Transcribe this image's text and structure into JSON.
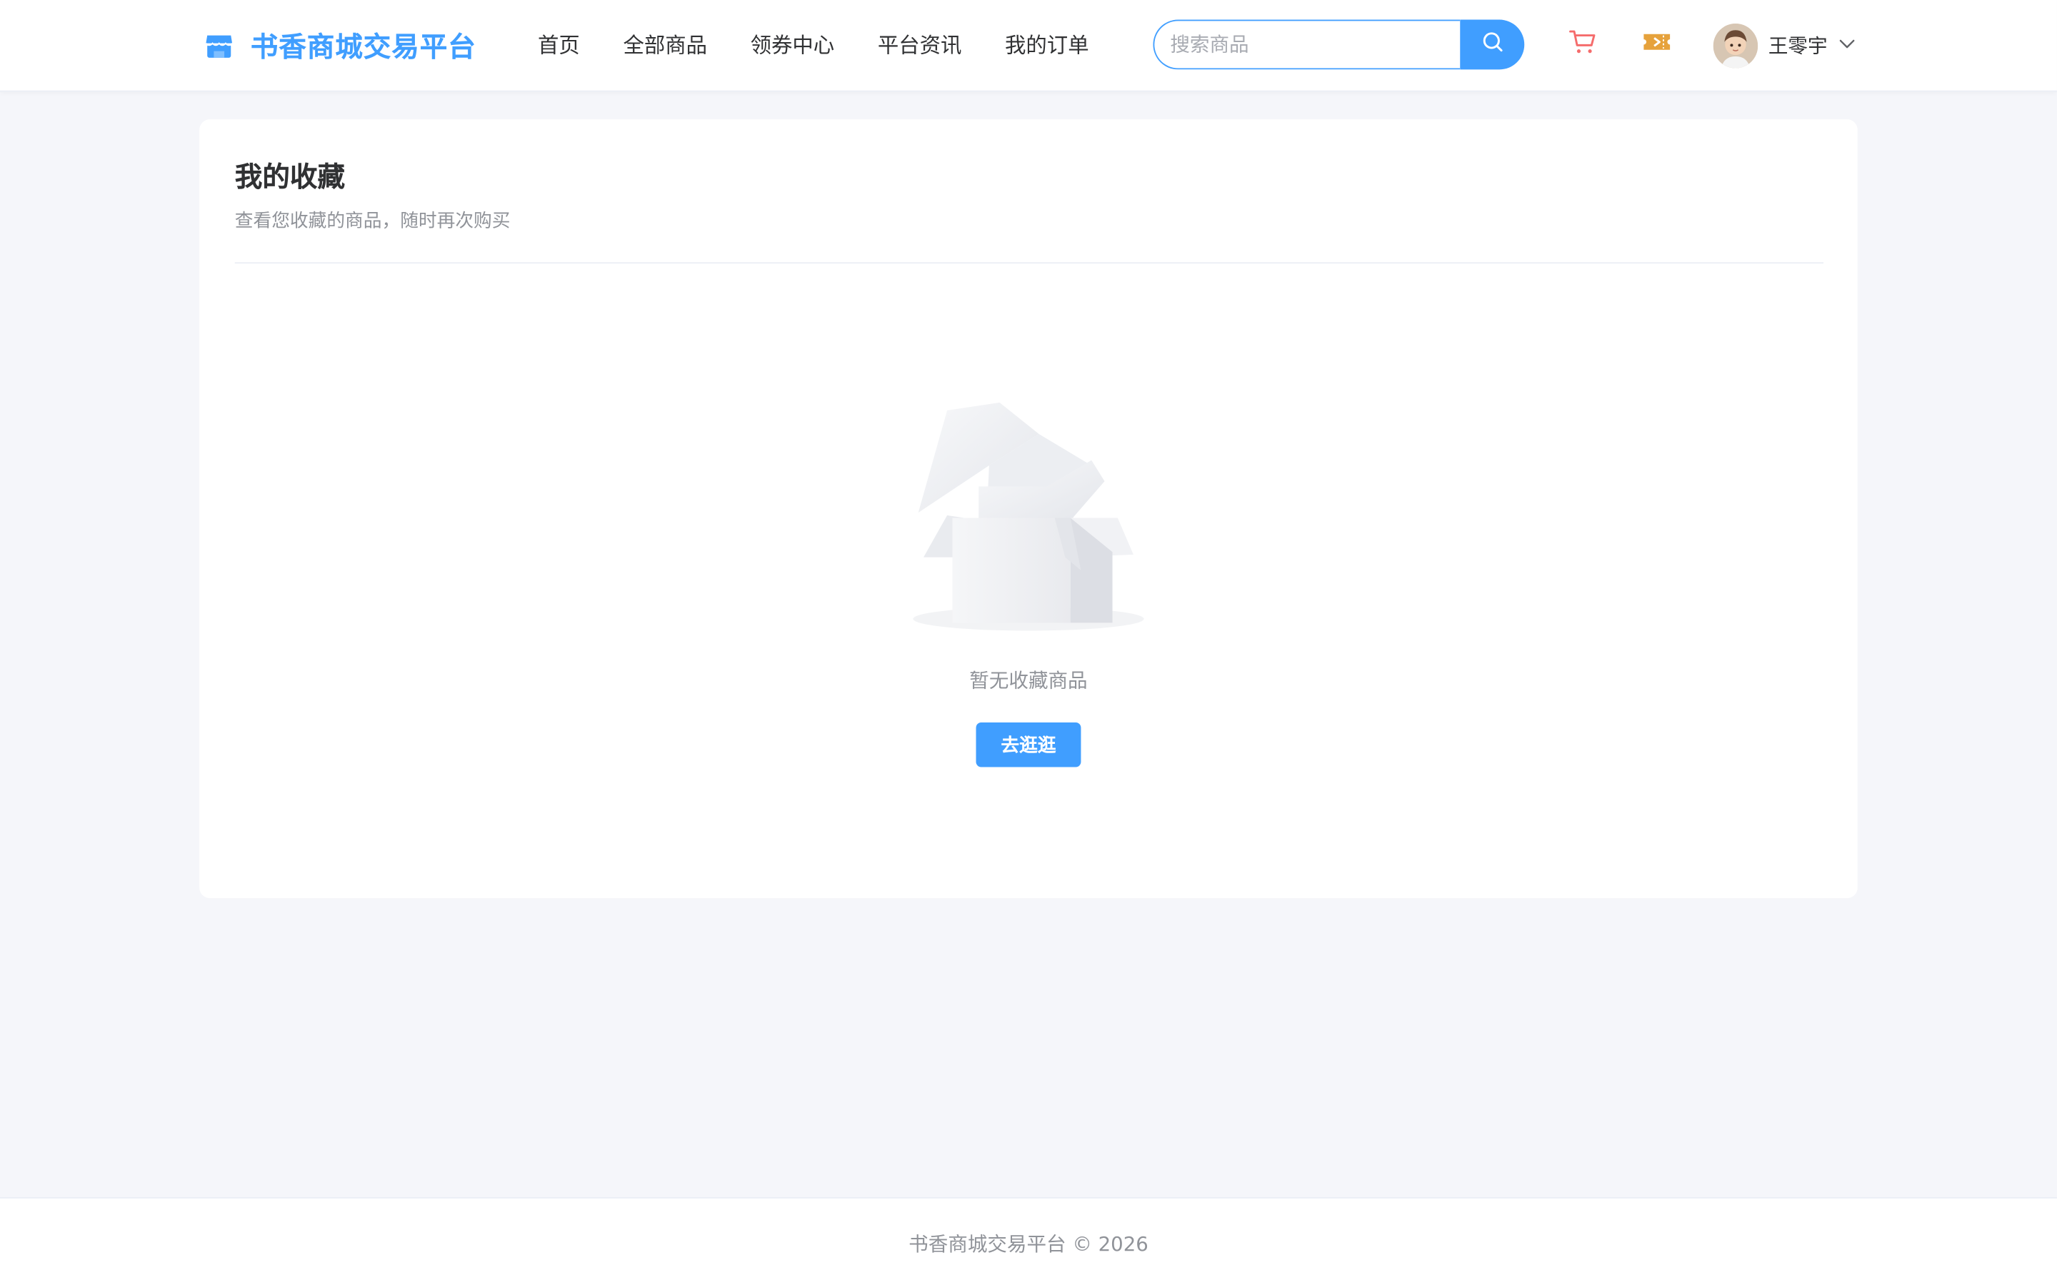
{
  "header": {
    "brand": "书香商城交易平台",
    "nav": [
      "首页",
      "全部商品",
      "领券中心",
      "平台资讯",
      "我的订单"
    ],
    "search": {
      "placeholder": "搜索商品",
      "value": ""
    },
    "user": {
      "name": "王零宇"
    },
    "icons": {
      "logo": "shop-icon",
      "search": "search-icon",
      "cart": "cart-icon",
      "coupon": "coupon-icon",
      "dropdown": "chevron-down-icon"
    }
  },
  "main": {
    "title": "我的收藏",
    "subtitle": "查看您收藏的商品，随时再次购买",
    "empty": {
      "text": "暂无收藏商品",
      "button": "去逛逛",
      "icon": "empty-box-icon"
    }
  },
  "footer": {
    "copyright": "书香商城交易平台 © 2026"
  },
  "colors": {
    "primary": "#409eff",
    "cart": "#f56c6c",
    "coupon": "#e6a23c",
    "background": "#f5f6fa"
  }
}
